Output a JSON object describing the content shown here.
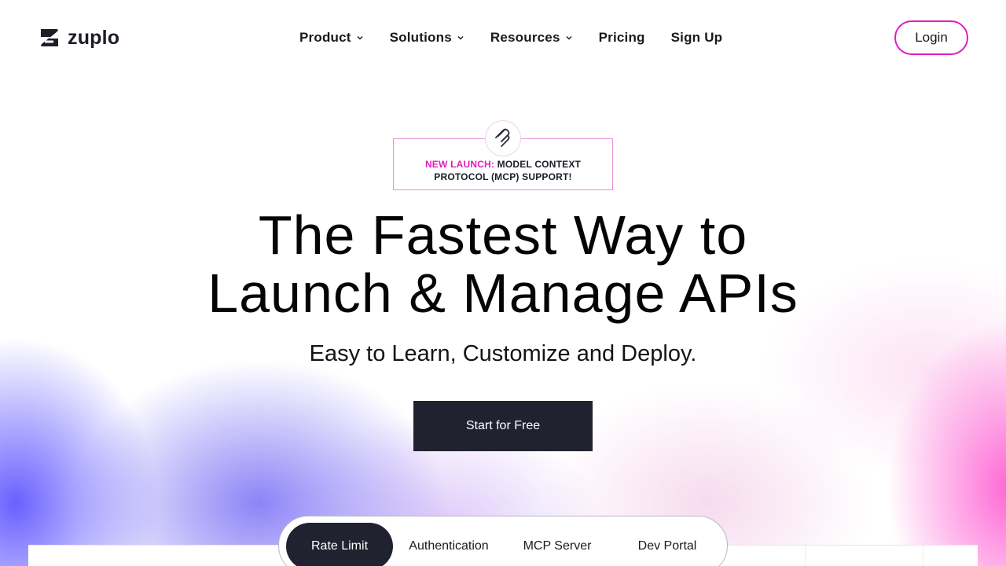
{
  "brand": {
    "name": "zuplo",
    "accent": "#e01bbe",
    "dark": "#20222f"
  },
  "nav": {
    "items": [
      {
        "label": "Product",
        "has_dropdown": true
      },
      {
        "label": "Solutions",
        "has_dropdown": true
      },
      {
        "label": "Resources",
        "has_dropdown": true
      },
      {
        "label": "Pricing",
        "has_dropdown": false
      },
      {
        "label": "Sign Up",
        "has_dropdown": false
      }
    ],
    "login_label": "Login"
  },
  "badge": {
    "icon": "mcp-icon",
    "highlight": "NEW LAUNCH:",
    "text_line1": "MODEL CONTEXT",
    "text_line2": "PROTOCOL (MCP) SUPPORT!"
  },
  "hero": {
    "title_line1": "The Fastest Way to",
    "title_line2": "Launch & Manage APIs",
    "subtitle": "Easy to Learn, Customize and Deploy.",
    "cta_label": "Start for Free"
  },
  "tabs": {
    "items": [
      "Rate Limit",
      "Authentication",
      "MCP Server",
      "Dev Portal"
    ],
    "selected": "Rate Limit"
  }
}
